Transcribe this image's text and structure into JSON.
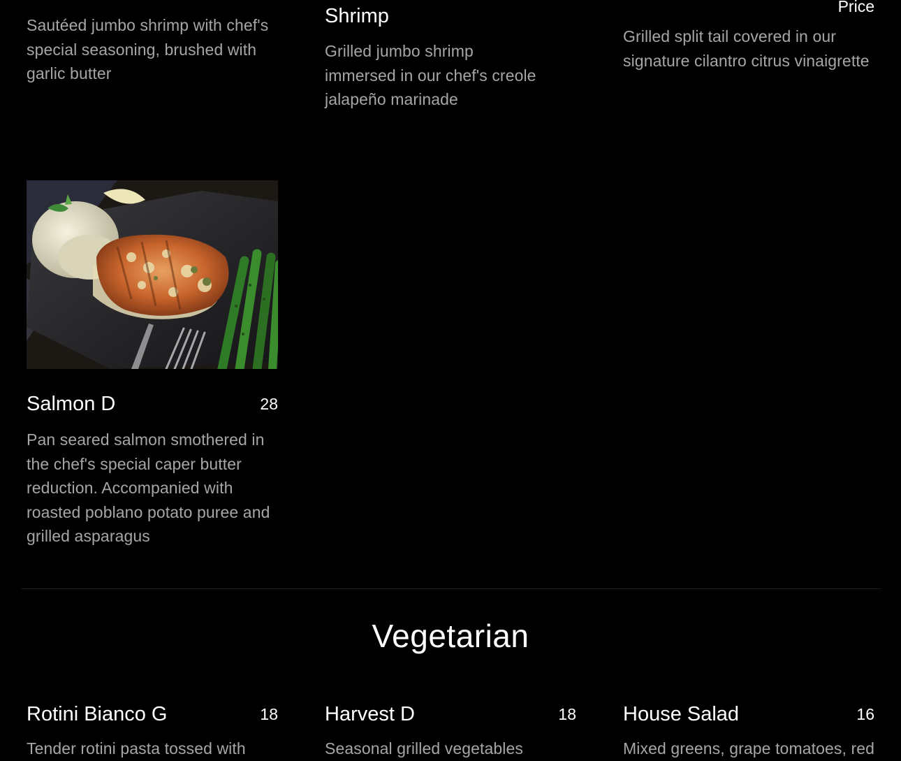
{
  "top_row": {
    "col1": {
      "description": [
        "Sautéed jumbo shrimp with chef's",
        "special seasoning, brushed with",
        "garlic butter"
      ]
    },
    "col2": {
      "name_tail": "Shrimp",
      "description": [
        "Grilled jumbo shrimp",
        "immersed in our chef's creole",
        "jalapeño marinade"
      ]
    },
    "col3": {
      "price": "Price",
      "description": [
        "Grilled split tail covered in our",
        "signature cilantro citrus vinaigrette"
      ]
    }
  },
  "salmon": {
    "image_icon": "salmon-dish-photo",
    "name": "Salmon D",
    "price": "28",
    "description": [
      "Pan seared salmon smothered in",
      "the chef's special caper butter",
      "reduction. Accompanied with",
      "roasted poblano potato puree and",
      "grilled asparagus"
    ]
  },
  "vegetarian": {
    "title": "Vegetarian",
    "items": [
      {
        "name": "Rotini Bianco G",
        "price": "18",
        "description_first": "Tender rotini pasta tossed with"
      },
      {
        "name": "Harvest D",
        "price": "18",
        "description_first": "Seasonal grilled vegetables"
      },
      {
        "name": "House Salad",
        "price": "16",
        "description_first": "Mixed greens, grape tomatoes, red"
      }
    ]
  },
  "colors": {
    "background": "#000000",
    "heading_text": "#ffffff",
    "description_text": "#a6a6a6",
    "divider": "#1e1e1e"
  }
}
